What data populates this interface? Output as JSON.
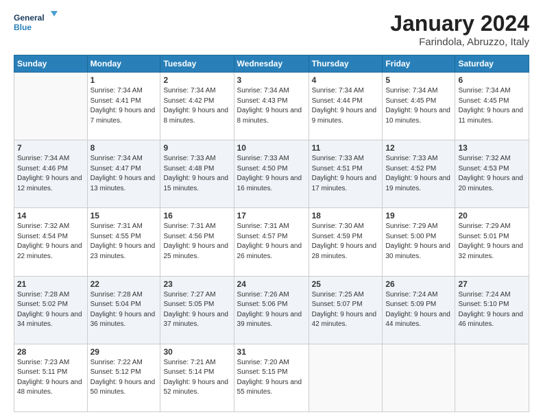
{
  "header": {
    "logo_line1": "General",
    "logo_line2": "Blue",
    "month": "January 2024",
    "location": "Farindola, Abruzzo, Italy"
  },
  "weekdays": [
    "Sunday",
    "Monday",
    "Tuesday",
    "Wednesday",
    "Thursday",
    "Friday",
    "Saturday"
  ],
  "weeks": [
    [
      {
        "day": "",
        "sunrise": "",
        "sunset": "",
        "daylight": ""
      },
      {
        "day": "1",
        "sunrise": "Sunrise: 7:34 AM",
        "sunset": "Sunset: 4:41 PM",
        "daylight": "Daylight: 9 hours and 7 minutes."
      },
      {
        "day": "2",
        "sunrise": "Sunrise: 7:34 AM",
        "sunset": "Sunset: 4:42 PM",
        "daylight": "Daylight: 9 hours and 8 minutes."
      },
      {
        "day": "3",
        "sunrise": "Sunrise: 7:34 AM",
        "sunset": "Sunset: 4:43 PM",
        "daylight": "Daylight: 9 hours and 8 minutes."
      },
      {
        "day": "4",
        "sunrise": "Sunrise: 7:34 AM",
        "sunset": "Sunset: 4:44 PM",
        "daylight": "Daylight: 9 hours and 9 minutes."
      },
      {
        "day": "5",
        "sunrise": "Sunrise: 7:34 AM",
        "sunset": "Sunset: 4:45 PM",
        "daylight": "Daylight: 9 hours and 10 minutes."
      },
      {
        "day": "6",
        "sunrise": "Sunrise: 7:34 AM",
        "sunset": "Sunset: 4:45 PM",
        "daylight": "Daylight: 9 hours and 11 minutes."
      }
    ],
    [
      {
        "day": "7",
        "sunrise": "Sunrise: 7:34 AM",
        "sunset": "Sunset: 4:46 PM",
        "daylight": "Daylight: 9 hours and 12 minutes."
      },
      {
        "day": "8",
        "sunrise": "Sunrise: 7:34 AM",
        "sunset": "Sunset: 4:47 PM",
        "daylight": "Daylight: 9 hours and 13 minutes."
      },
      {
        "day": "9",
        "sunrise": "Sunrise: 7:33 AM",
        "sunset": "Sunset: 4:48 PM",
        "daylight": "Daylight: 9 hours and 15 minutes."
      },
      {
        "day": "10",
        "sunrise": "Sunrise: 7:33 AM",
        "sunset": "Sunset: 4:50 PM",
        "daylight": "Daylight: 9 hours and 16 minutes."
      },
      {
        "day": "11",
        "sunrise": "Sunrise: 7:33 AM",
        "sunset": "Sunset: 4:51 PM",
        "daylight": "Daylight: 9 hours and 17 minutes."
      },
      {
        "day": "12",
        "sunrise": "Sunrise: 7:33 AM",
        "sunset": "Sunset: 4:52 PM",
        "daylight": "Daylight: 9 hours and 19 minutes."
      },
      {
        "day": "13",
        "sunrise": "Sunrise: 7:32 AM",
        "sunset": "Sunset: 4:53 PM",
        "daylight": "Daylight: 9 hours and 20 minutes."
      }
    ],
    [
      {
        "day": "14",
        "sunrise": "Sunrise: 7:32 AM",
        "sunset": "Sunset: 4:54 PM",
        "daylight": "Daylight: 9 hours and 22 minutes."
      },
      {
        "day": "15",
        "sunrise": "Sunrise: 7:31 AM",
        "sunset": "Sunset: 4:55 PM",
        "daylight": "Daylight: 9 hours and 23 minutes."
      },
      {
        "day": "16",
        "sunrise": "Sunrise: 7:31 AM",
        "sunset": "Sunset: 4:56 PM",
        "daylight": "Daylight: 9 hours and 25 minutes."
      },
      {
        "day": "17",
        "sunrise": "Sunrise: 7:31 AM",
        "sunset": "Sunset: 4:57 PM",
        "daylight": "Daylight: 9 hours and 26 minutes."
      },
      {
        "day": "18",
        "sunrise": "Sunrise: 7:30 AM",
        "sunset": "Sunset: 4:59 PM",
        "daylight": "Daylight: 9 hours and 28 minutes."
      },
      {
        "day": "19",
        "sunrise": "Sunrise: 7:29 AM",
        "sunset": "Sunset: 5:00 PM",
        "daylight": "Daylight: 9 hours and 30 minutes."
      },
      {
        "day": "20",
        "sunrise": "Sunrise: 7:29 AM",
        "sunset": "Sunset: 5:01 PM",
        "daylight": "Daylight: 9 hours and 32 minutes."
      }
    ],
    [
      {
        "day": "21",
        "sunrise": "Sunrise: 7:28 AM",
        "sunset": "Sunset: 5:02 PM",
        "daylight": "Daylight: 9 hours and 34 minutes."
      },
      {
        "day": "22",
        "sunrise": "Sunrise: 7:28 AM",
        "sunset": "Sunset: 5:04 PM",
        "daylight": "Daylight: 9 hours and 36 minutes."
      },
      {
        "day": "23",
        "sunrise": "Sunrise: 7:27 AM",
        "sunset": "Sunset: 5:05 PM",
        "daylight": "Daylight: 9 hours and 37 minutes."
      },
      {
        "day": "24",
        "sunrise": "Sunrise: 7:26 AM",
        "sunset": "Sunset: 5:06 PM",
        "daylight": "Daylight: 9 hours and 39 minutes."
      },
      {
        "day": "25",
        "sunrise": "Sunrise: 7:25 AM",
        "sunset": "Sunset: 5:07 PM",
        "daylight": "Daylight: 9 hours and 42 minutes."
      },
      {
        "day": "26",
        "sunrise": "Sunrise: 7:24 AM",
        "sunset": "Sunset: 5:09 PM",
        "daylight": "Daylight: 9 hours and 44 minutes."
      },
      {
        "day": "27",
        "sunrise": "Sunrise: 7:24 AM",
        "sunset": "Sunset: 5:10 PM",
        "daylight": "Daylight: 9 hours and 46 minutes."
      }
    ],
    [
      {
        "day": "28",
        "sunrise": "Sunrise: 7:23 AM",
        "sunset": "Sunset: 5:11 PM",
        "daylight": "Daylight: 9 hours and 48 minutes."
      },
      {
        "day": "29",
        "sunrise": "Sunrise: 7:22 AM",
        "sunset": "Sunset: 5:12 PM",
        "daylight": "Daylight: 9 hours and 50 minutes."
      },
      {
        "day": "30",
        "sunrise": "Sunrise: 7:21 AM",
        "sunset": "Sunset: 5:14 PM",
        "daylight": "Daylight: 9 hours and 52 minutes."
      },
      {
        "day": "31",
        "sunrise": "Sunrise: 7:20 AM",
        "sunset": "Sunset: 5:15 PM",
        "daylight": "Daylight: 9 hours and 55 minutes."
      },
      {
        "day": "",
        "sunrise": "",
        "sunset": "",
        "daylight": ""
      },
      {
        "day": "",
        "sunrise": "",
        "sunset": "",
        "daylight": ""
      },
      {
        "day": "",
        "sunrise": "",
        "sunset": "",
        "daylight": ""
      }
    ]
  ]
}
